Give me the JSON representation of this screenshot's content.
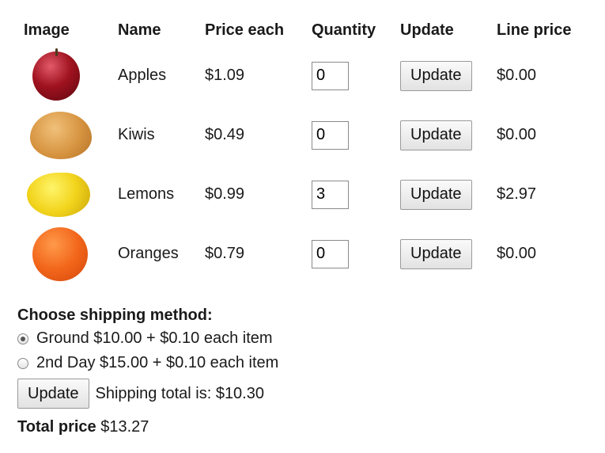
{
  "table": {
    "headers": {
      "image": "Image",
      "name": "Name",
      "price": "Price each",
      "quantity": "Quantity",
      "update": "Update",
      "line": "Line price"
    },
    "rows": [
      {
        "name": "Apples",
        "price": "$1.09",
        "quantity": "0",
        "update_label": "Update",
        "line_price": "$0.00",
        "image": "apple"
      },
      {
        "name": "Kiwis",
        "price": "$0.49",
        "quantity": "0",
        "update_label": "Update",
        "line_price": "$0.00",
        "image": "kiwi"
      },
      {
        "name": "Lemons",
        "price": "$0.99",
        "quantity": "3",
        "update_label": "Update",
        "line_price": "$2.97",
        "image": "lemon"
      },
      {
        "name": "Oranges",
        "price": "$0.79",
        "quantity": "0",
        "update_label": "Update",
        "line_price": "$0.00",
        "image": "orange"
      }
    ]
  },
  "shipping": {
    "title": "Choose shipping method:",
    "options": [
      {
        "label": "Ground $10.00 + $0.10 each item",
        "checked": true
      },
      {
        "label": "2nd Day $15.00 + $0.10 each item",
        "checked": false
      }
    ],
    "update_label": "Update",
    "total_text": "Shipping total is: $10.30"
  },
  "total": {
    "label": "Total price",
    "value": "$13.27"
  }
}
